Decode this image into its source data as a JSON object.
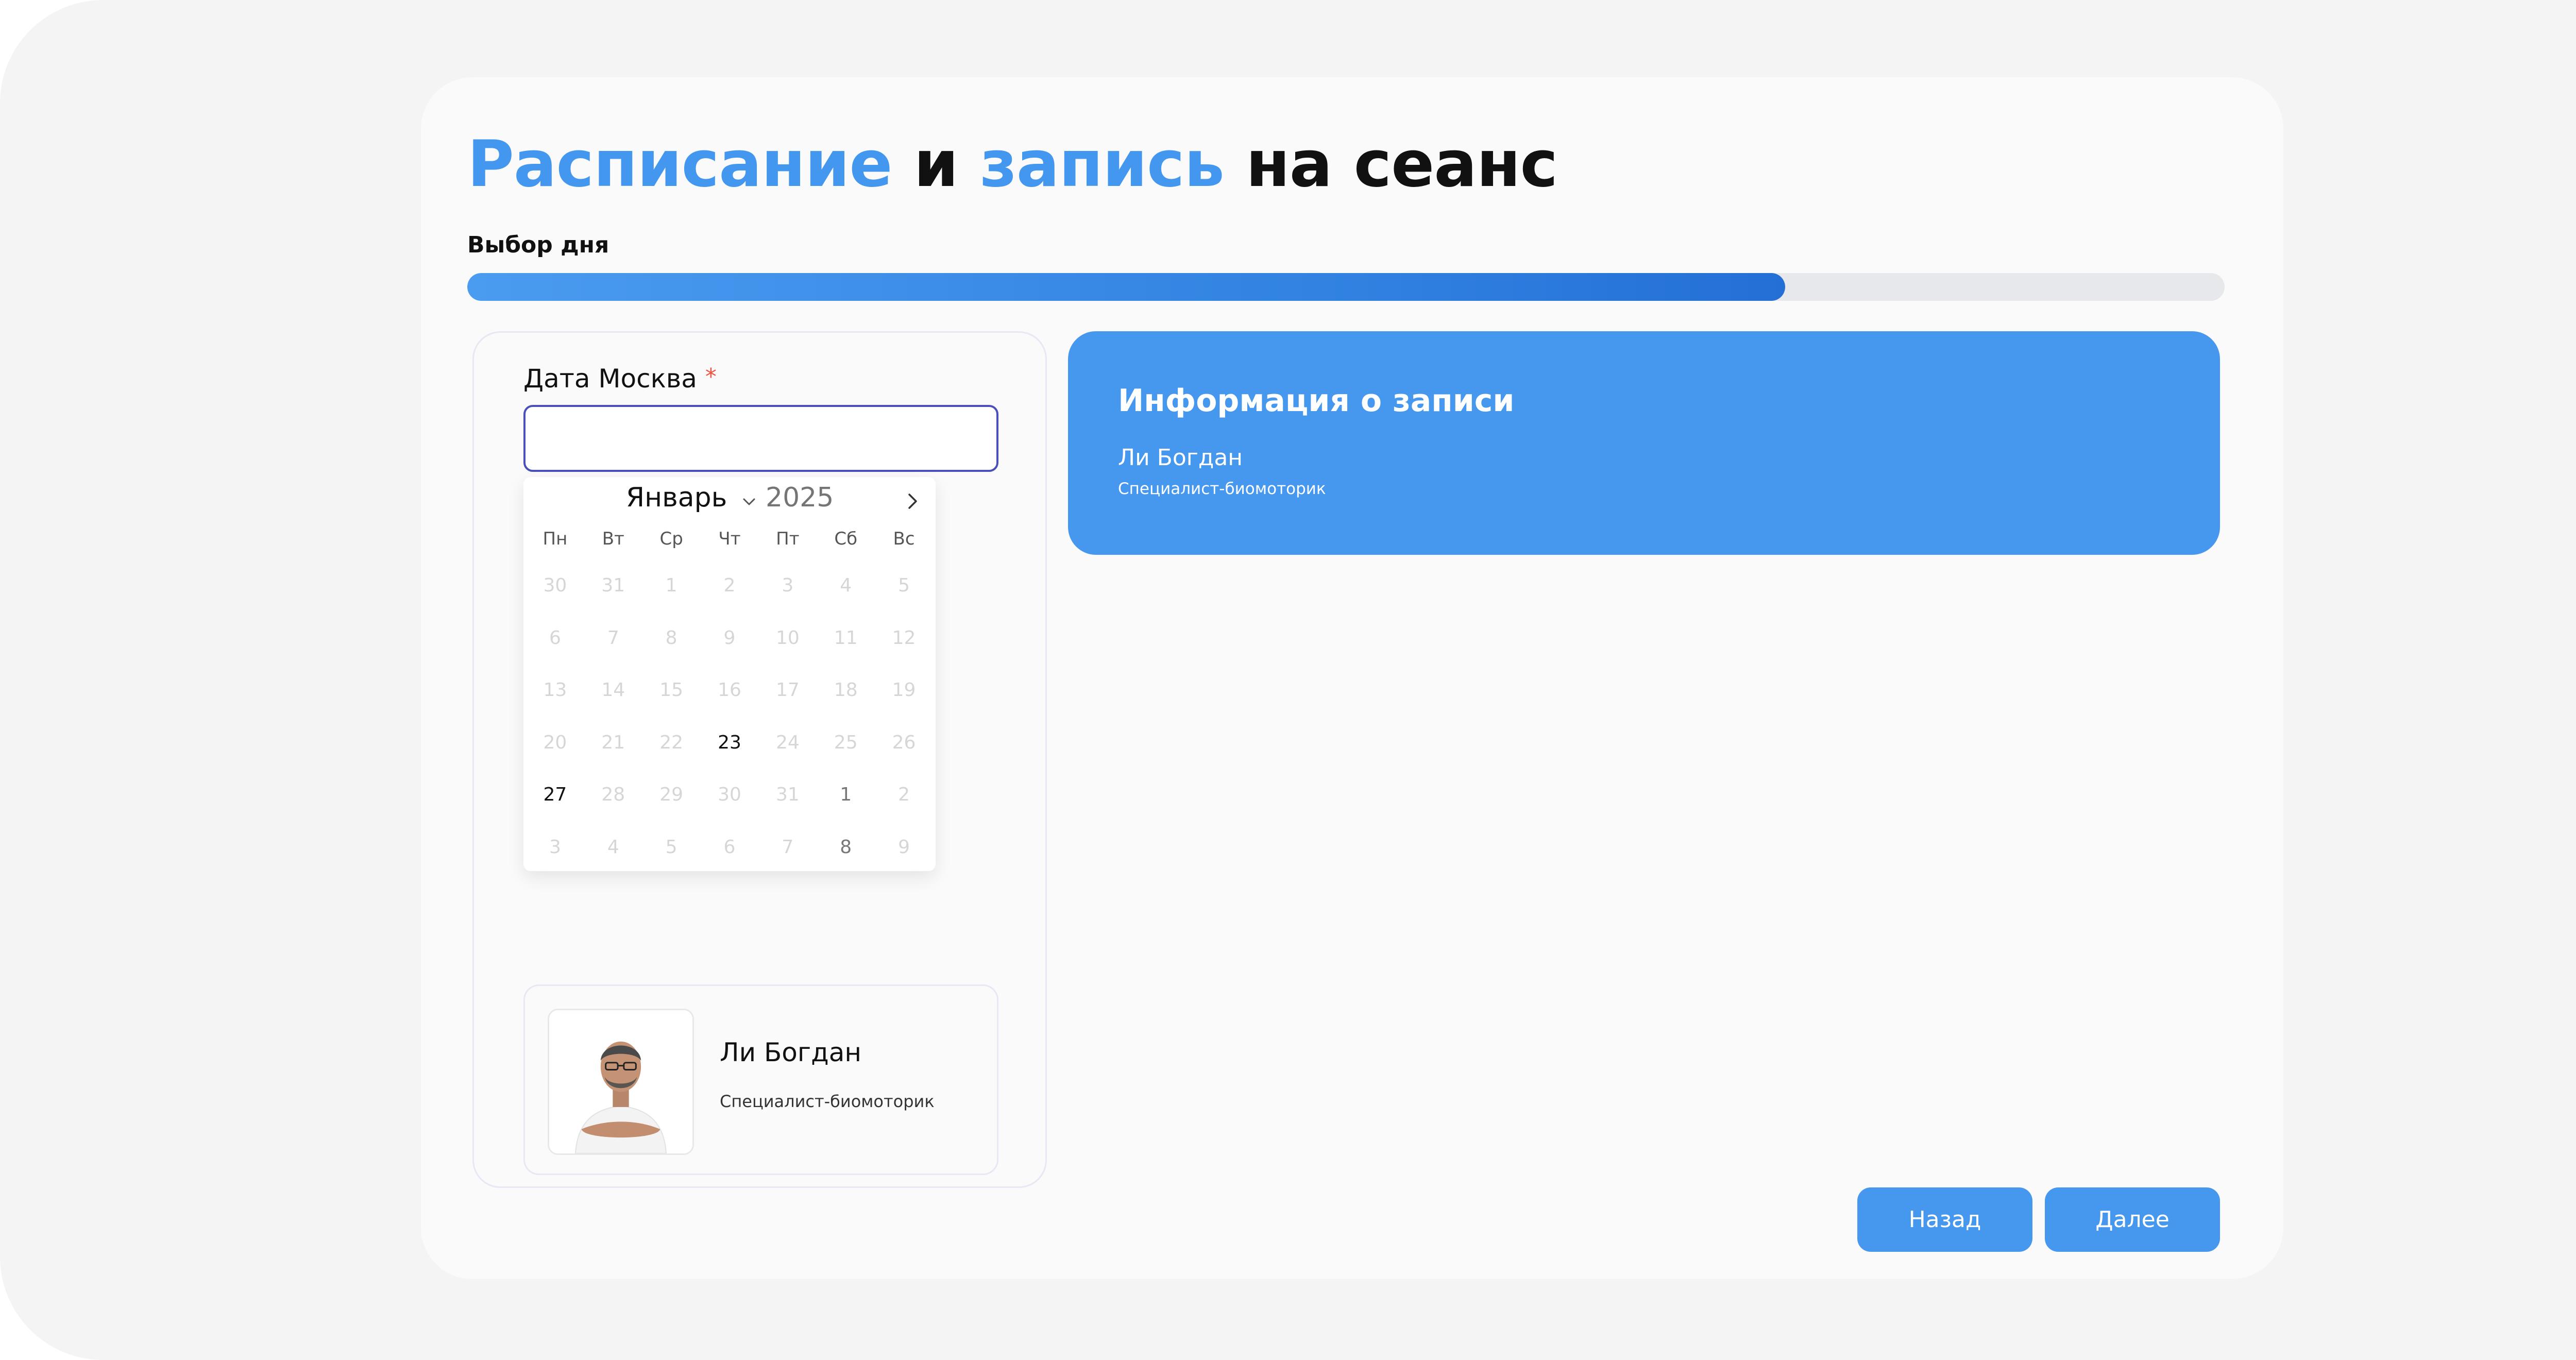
{
  "header": {
    "title_parts": [
      "Расписание",
      "и",
      "запись",
      "на сеанс"
    ]
  },
  "progress": {
    "step_label": "Выбор дня",
    "value_percent": 75
  },
  "form": {
    "date_label": "Дата Москва",
    "required_mark": "*",
    "date_value": ""
  },
  "calendar": {
    "month": "Январь",
    "year": "2025",
    "weekdays": [
      "Пн",
      "Вт",
      "Ср",
      "Чт",
      "Пт",
      "Сб",
      "Вс"
    ],
    "weeks": [
      [
        {
          "d": "30",
          "s": "disabled"
        },
        {
          "d": "31",
          "s": "disabled"
        },
        {
          "d": "1",
          "s": "disabled"
        },
        {
          "d": "2",
          "s": "disabled"
        },
        {
          "d": "3",
          "s": "disabled"
        },
        {
          "d": "4",
          "s": "disabled"
        },
        {
          "d": "5",
          "s": "disabled"
        }
      ],
      [
        {
          "d": "6",
          "s": "disabled"
        },
        {
          "d": "7",
          "s": "disabled"
        },
        {
          "d": "8",
          "s": "disabled"
        },
        {
          "d": "9",
          "s": "disabled"
        },
        {
          "d": "10",
          "s": "disabled"
        },
        {
          "d": "11",
          "s": "disabled"
        },
        {
          "d": "12",
          "s": "disabled"
        }
      ],
      [
        {
          "d": "13",
          "s": "disabled"
        },
        {
          "d": "14",
          "s": "disabled"
        },
        {
          "d": "15",
          "s": "disabled"
        },
        {
          "d": "16",
          "s": "disabled"
        },
        {
          "d": "17",
          "s": "disabled"
        },
        {
          "d": "18",
          "s": "disabled"
        },
        {
          "d": "19",
          "s": "disabled"
        }
      ],
      [
        {
          "d": "20",
          "s": "disabled"
        },
        {
          "d": "21",
          "s": "disabled"
        },
        {
          "d": "22",
          "s": "disabled"
        },
        {
          "d": "23",
          "s": "available"
        },
        {
          "d": "24",
          "s": "disabled"
        },
        {
          "d": "25",
          "s": "disabled"
        },
        {
          "d": "26",
          "s": "disabled"
        }
      ],
      [
        {
          "d": "27",
          "s": "available"
        },
        {
          "d": "28",
          "s": "disabled"
        },
        {
          "d": "29",
          "s": "disabled"
        },
        {
          "d": "30",
          "s": "disabled"
        },
        {
          "d": "31",
          "s": "disabled"
        },
        {
          "d": "1",
          "s": "other"
        },
        {
          "d": "2",
          "s": "disabled"
        }
      ],
      [
        {
          "d": "3",
          "s": "disabled"
        },
        {
          "d": "4",
          "s": "disabled"
        },
        {
          "d": "5",
          "s": "disabled"
        },
        {
          "d": "6",
          "s": "disabled"
        },
        {
          "d": "7",
          "s": "disabled"
        },
        {
          "d": "8",
          "s": "other"
        },
        {
          "d": "9",
          "s": "disabled"
        }
      ]
    ]
  },
  "specialist": {
    "name": "Ли Богдан",
    "role": "Специалист-биомоторик"
  },
  "info": {
    "title": "Информация о записи",
    "name": "Ли Богдан",
    "role": "Специалист-биомоторик"
  },
  "buttons": {
    "back": "Назад",
    "next": "Далее"
  },
  "colors": {
    "accent": "#4698ef",
    "required": "#f0533f",
    "input_border": "#4b4fb8"
  }
}
